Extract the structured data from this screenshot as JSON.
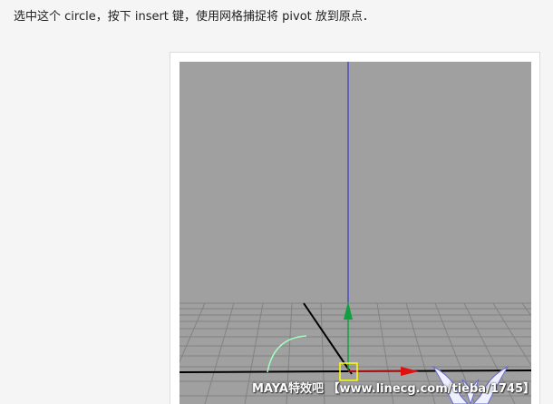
{
  "instruction": {
    "text": "选中这个 circle，按下 insert 键，使用网格捕捉将 pivot 放到原点．"
  },
  "viewport": {
    "background_color": "#a0a0a0",
    "grid_color": "#808080",
    "axis_line_color": "#000000",
    "y_axis_color": "#2222cc",
    "pivot_manipulator": {
      "x_handle_color": "#e01010",
      "y_handle_color": "#10a040",
      "center_color": "#ffff00"
    },
    "circle_color": "#a0ffc0"
  },
  "watermark": {
    "text": "MAYA特效吧 【www.linecg.com/tieba/1745】",
    "logo_icon": "winged-emblem-icon"
  }
}
